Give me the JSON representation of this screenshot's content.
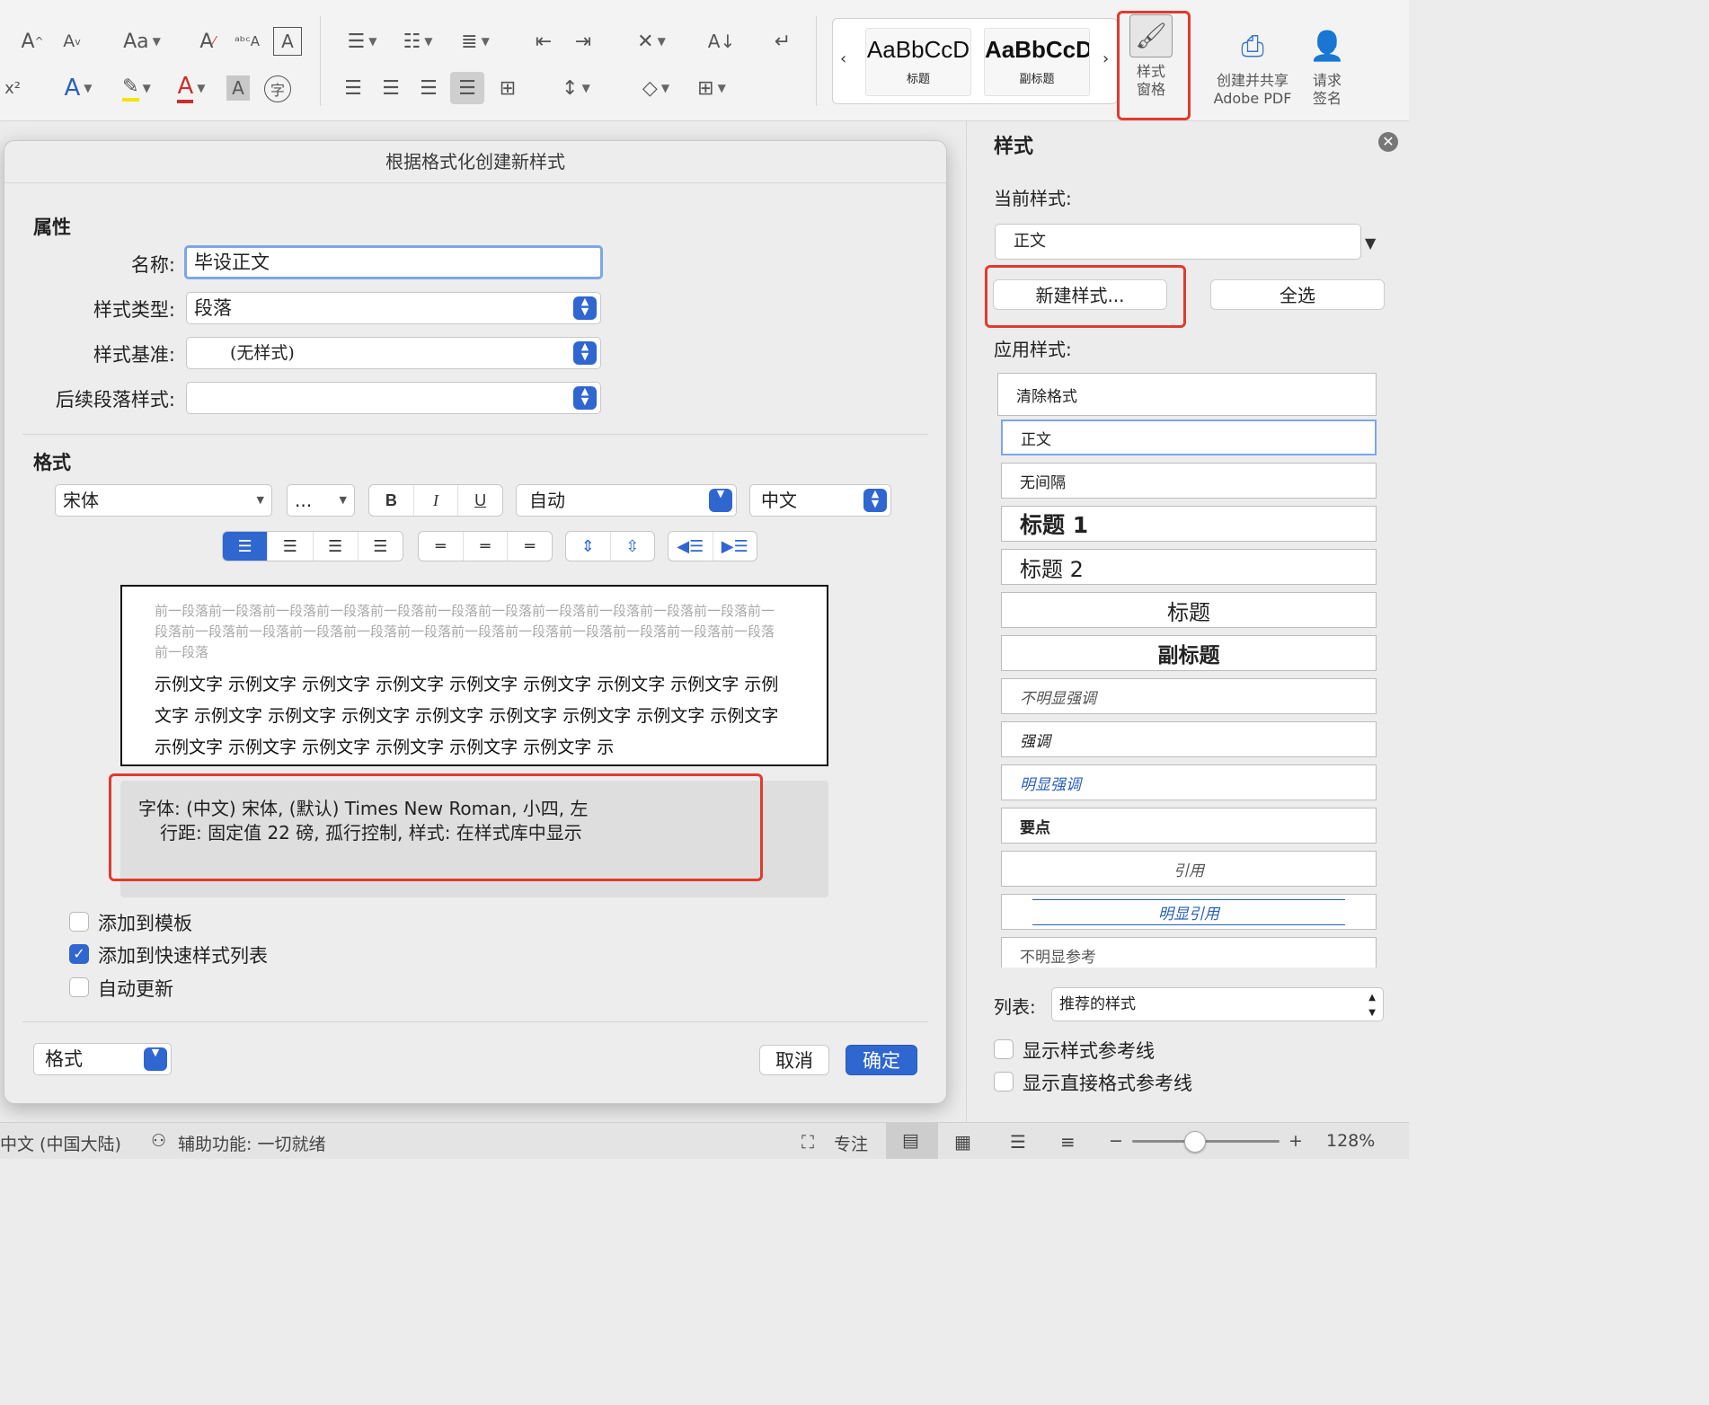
{
  "ribbon": {
    "styles_gallery": [
      {
        "sample": "AaBbCcD",
        "caption": "标题"
      },
      {
        "sample": "AaBbCcD",
        "caption": "副标题"
      }
    ],
    "styles_pane_button": {
      "line1": "样式",
      "line2": "窗格"
    },
    "create_share_pdf": {
      "line1": "创建并共享",
      "line2": "Adobe PDF"
    },
    "request_signature": {
      "line1": "请求",
      "line2": "签名"
    }
  },
  "dialog": {
    "title": "根据格式化创建新样式",
    "properties_heading": "属性",
    "name_label": "名称:",
    "name_value": "毕设正文",
    "style_type_label": "样式类型:",
    "style_type_value": "段落",
    "style_based_on_label": "样式基准:",
    "style_based_on_value": "(无样式)",
    "following_style_label": "后续段落样式:",
    "following_style_value": "",
    "format_heading": "格式",
    "font_value": "宋体",
    "size_value": "...",
    "color_value": "自动",
    "language_value": "中文",
    "preview_previous": "前一段落前一段落前一段落前一段落前一段落前一段落前一段落前一段落前一段落前一段落前一段落前一段落前一段落前一段落前一段落前一段落前一段落前一段落前一段落前一段落前一段落前一段落前一段落前一段落",
    "preview_sample": "示例文字 示例文字 示例文字 示例文字 示例文字 示例文字 示例文字 示例文字 示例文字 示例文字 示例文字 示例文字 示例文字 示例文字 示例文字 示例文字 示例文字 示例文字 示例文字 示例文字 示例文字 示例文字 示例文字 示",
    "description_line1": "字体: (中文) 宋体, (默认) Times New Roman, 小四, 左",
    "description_line2": "行距: 固定值 22 磅, 孤行控制, 样式: 在样式库中显示",
    "checkboxes": [
      {
        "label": "添加到模板",
        "checked": false
      },
      {
        "label": "添加到快速样式列表",
        "checked": true
      },
      {
        "label": "自动更新",
        "checked": false
      }
    ],
    "format_menu_label": "格式",
    "cancel_label": "取消",
    "ok_label": "确定"
  },
  "pane": {
    "title": "样式",
    "current_style_label": "当前样式:",
    "current_style_value": "正文",
    "new_style_button": "新建样式...",
    "select_all_button": "全选",
    "apply_style_label": "应用样式:",
    "styles": [
      "清除格式",
      "正文",
      "无间隔",
      "标题 1",
      "标题 2",
      "标题",
      "副标题",
      "不明显强调",
      "强调",
      "明显强调",
      "要点",
      "引用",
      "明显引用",
      "不明显参考"
    ],
    "list_label": "列表:",
    "list_value": "推荐的样式",
    "show_style_guides": "显示样式参考线",
    "show_direct_format_guides": "显示直接格式参考线"
  },
  "status": {
    "language": "中文 (中国大陆)",
    "accessibility": "辅助功能: 一切就绪",
    "focus": "专注",
    "zoom": "128%",
    "zoom_fraction": 0.42
  },
  "colors": {
    "accent": "#2f66d0",
    "highlight_red": "#e13a2f",
    "link_blue": "#2b5fb8"
  }
}
